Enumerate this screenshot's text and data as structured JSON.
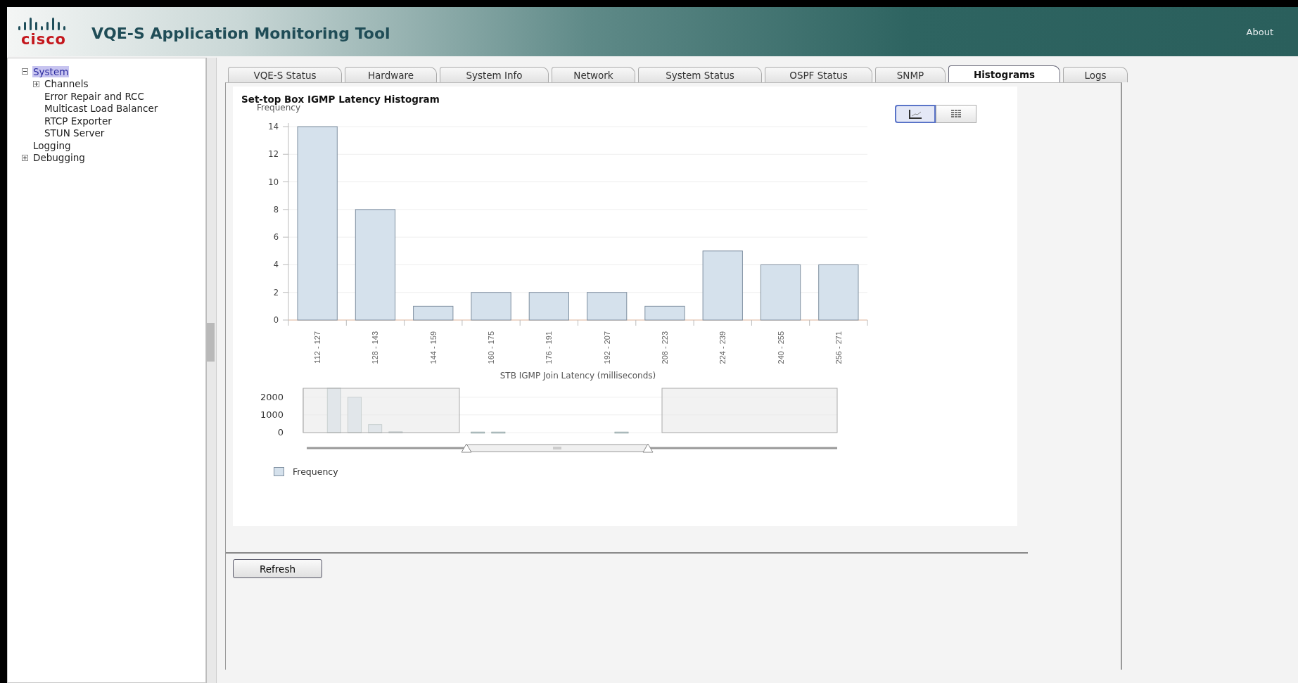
{
  "header": {
    "logo_text": "cisco",
    "title": "VQE-S Application Monitoring Tool",
    "about_link": "About"
  },
  "sidebar": {
    "tree": [
      {
        "label": "System",
        "selected": true,
        "expanded": true,
        "children": [
          {
            "label": "Channels",
            "selected": false,
            "expanded": false
          },
          {
            "label": "Error Repair and RCC",
            "selected": false
          },
          {
            "label": "Multicast Load Balancer",
            "selected": false
          },
          {
            "label": "RTCP Exporter",
            "selected": false
          },
          {
            "label": "STUN Server",
            "selected": false
          }
        ]
      },
      {
        "label": "Logging",
        "selected": false
      },
      {
        "label": "Debugging",
        "selected": false,
        "expanded": false
      }
    ]
  },
  "tabs": [
    {
      "label": "VQE-S Status",
      "selected": false
    },
    {
      "label": "Hardware",
      "selected": false
    },
    {
      "label": "System Info",
      "selected": false
    },
    {
      "label": "Network",
      "selected": false
    },
    {
      "label": "System Status",
      "selected": false
    },
    {
      "label": "OSPF Status",
      "selected": false
    },
    {
      "label": "SNMP",
      "selected": false
    },
    {
      "label": "Histograms",
      "selected": true
    },
    {
      "label": "Logs",
      "selected": false
    }
  ],
  "view_toggle": [
    {
      "kind": "chart",
      "selected": true
    },
    {
      "kind": "table",
      "selected": false
    }
  ],
  "histogram": {
    "chart_data": {
      "type": "bar",
      "title": "Set-top Box IGMP Latency Histogram",
      "xlabel": "STB IGMP Join Latency (milliseconds)",
      "ylabel": "Frequency",
      "categories": [
        "112 - 127",
        "128 - 143",
        "144 - 159",
        "160 - 175",
        "176 - 191",
        "192 - 207",
        "208 - 223",
        "224 - 239",
        "240 - 255",
        "256 - 271"
      ],
      "series": [
        {
          "name": "Frequency",
          "color": "#d5e1ec",
          "values": [
            14,
            8,
            1,
            2,
            2,
            2,
            1,
            5,
            4,
            4
          ]
        }
      ],
      "ylim": [
        0,
        14
      ],
      "yticks": [
        0,
        2,
        4,
        6,
        8,
        10,
        12,
        14
      ],
      "grid": true
    }
  },
  "overview": {
    "chart_data": {
      "type": "bar",
      "series": [
        {
          "color": "#d5e1ec",
          "values": [
            null,
            2500,
            2000,
            450,
            50,
            null,
            null,
            null,
            30,
            30,
            null,
            null,
            null,
            null,
            null,
            30,
            null,
            null,
            null,
            null,
            null,
            null,
            null,
            null,
            null,
            null
          ]
        }
      ],
      "ylim": [
        0,
        2500
      ],
      "yticks": [
        0,
        1000,
        2000
      ]
    }
  },
  "buttons": [
    {
      "label": "Refresh"
    }
  ]
}
